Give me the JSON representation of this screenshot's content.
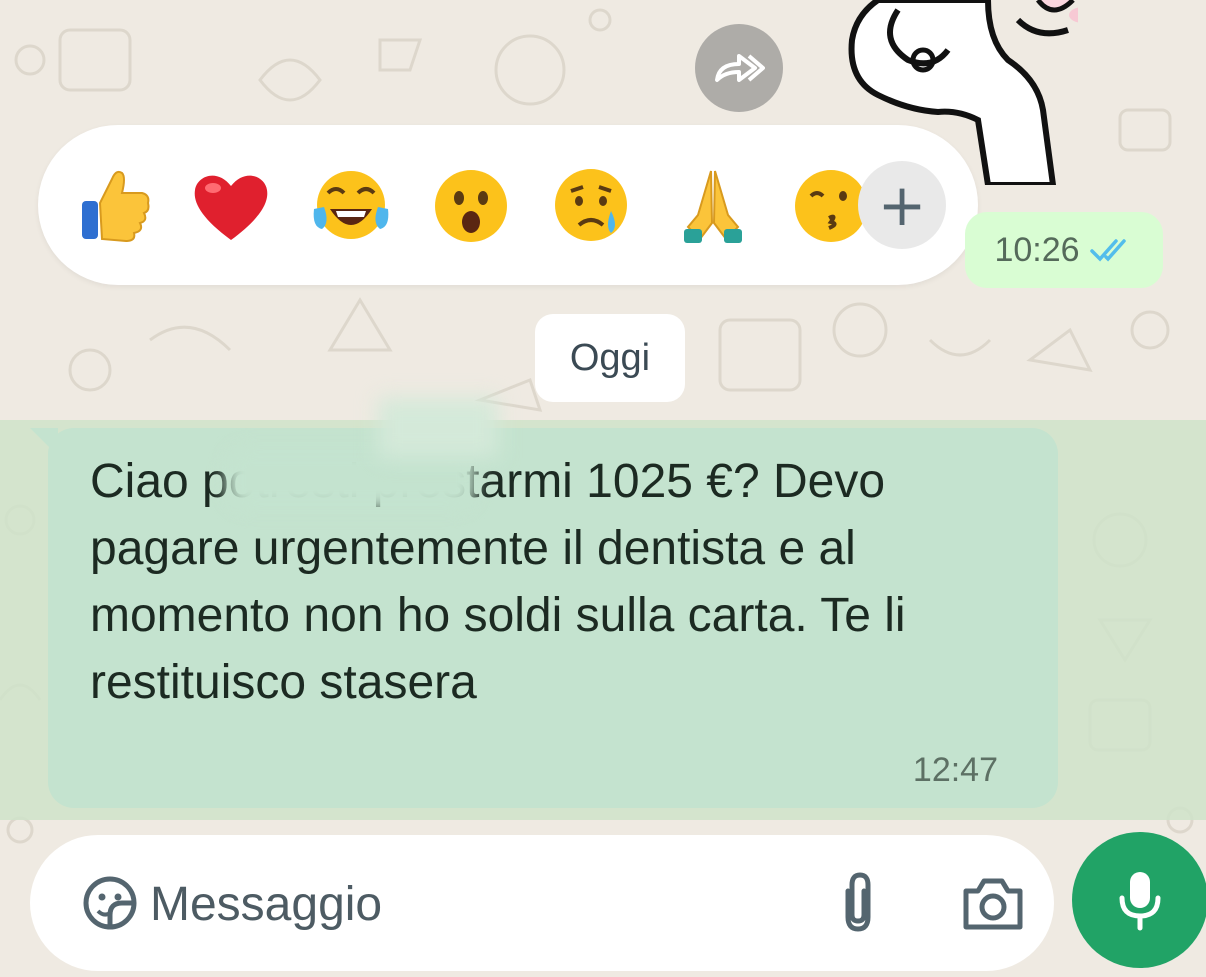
{
  "reactions": {
    "items": [
      {
        "name": "thumbs-up",
        "glyph": "👍"
      },
      {
        "name": "heart",
        "glyph": "❤️"
      },
      {
        "name": "tears-of-joy",
        "glyph": "😂"
      },
      {
        "name": "surprised",
        "glyph": "😮"
      },
      {
        "name": "sad-tear",
        "glyph": "😥"
      },
      {
        "name": "praying-hands",
        "glyph": "🙏"
      },
      {
        "name": "kiss",
        "glyph": "😘"
      }
    ],
    "more_label": "+"
  },
  "previous_message": {
    "time": "10:26",
    "status_icon": "double-check-read-icon"
  },
  "date_chip": "Oggi",
  "incoming_message": {
    "text_prefix": "Ciao",
    "text_rest": " potresti prestarmi 1025 €? Devo pagare urgentemente il dentista e al momento non ho soldi sulla carta. Te li restituisco stasera",
    "time": "12:47"
  },
  "composer": {
    "placeholder": "Messaggio"
  },
  "colors": {
    "background": "#efeae2",
    "incoming_bubble": "#c4e3cf",
    "outgoing_bubble": "#d9fdd3",
    "accent_green": "#21a366",
    "read_tick_blue": "#53bdeb"
  }
}
